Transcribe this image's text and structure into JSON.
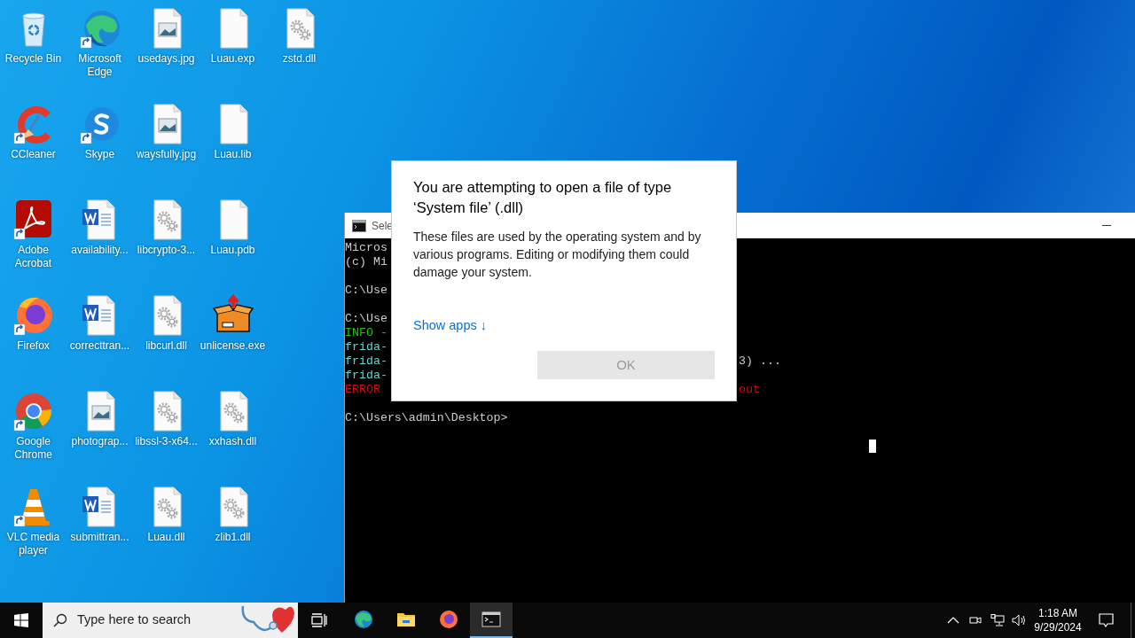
{
  "desktop_rows": [
    [
      {
        "label": "Recycle Bin",
        "kind": "recycle",
        "shortcut": false
      },
      {
        "label": "Microsoft Edge",
        "kind": "edge",
        "shortcut": true
      },
      {
        "label": "usedays.jpg",
        "kind": "image",
        "shortcut": false
      },
      {
        "label": "Luau.exp",
        "kind": "blank",
        "shortcut": false
      },
      {
        "label": "zstd.dll",
        "kind": "dll",
        "shortcut": false
      }
    ],
    [
      {
        "label": "CCleaner",
        "kind": "ccleaner",
        "shortcut": true
      },
      {
        "label": "Skype",
        "kind": "skype",
        "shortcut": true
      },
      {
        "label": "waysfully.jpg",
        "kind": "image",
        "shortcut": false
      },
      {
        "label": "Luau.lib",
        "kind": "blank",
        "shortcut": false
      }
    ],
    [
      {
        "label": "Adobe Acrobat",
        "kind": "pdf",
        "shortcut": true
      },
      {
        "label": "availability...",
        "kind": "word",
        "shortcut": false
      },
      {
        "label": "libcrypto-3...",
        "kind": "dll",
        "shortcut": false
      },
      {
        "label": "Luau.pdb",
        "kind": "blank",
        "shortcut": false
      }
    ],
    [
      {
        "label": "Firefox",
        "kind": "firefox",
        "shortcut": true
      },
      {
        "label": "correcttran...",
        "kind": "word",
        "shortcut": false
      },
      {
        "label": "libcurl.dll",
        "kind": "dll",
        "shortcut": false
      },
      {
        "label": "unlicense.exe",
        "kind": "package",
        "shortcut": false
      }
    ],
    [
      {
        "label": "Google Chrome",
        "kind": "chrome",
        "shortcut": true
      },
      {
        "label": "photograp...",
        "kind": "image",
        "shortcut": false
      },
      {
        "label": "libssl-3-x64...",
        "kind": "dll",
        "shortcut": false
      },
      {
        "label": "xxhash.dll",
        "kind": "dll",
        "shortcut": false
      }
    ],
    [
      {
        "label": "VLC media player",
        "kind": "vlc",
        "shortcut": true
      },
      {
        "label": "submittran...",
        "kind": "word",
        "shortcut": false
      },
      {
        "label": "Luau.dll",
        "kind": "dll",
        "shortcut": false
      },
      {
        "label": "zlib1.dll",
        "kind": "dll",
        "shortcut": false
      }
    ]
  ],
  "console": {
    "title": "Sele",
    "blocks": [
      [
        {
          "text": "Micros",
          "color": "#cccccc"
        },
        {
          "text": "(c) Mi",
          "color": "#cccccc"
        }
      ],
      [
        {
          "text": "C:\\Use",
          "color": "#cccccc"
        }
      ],
      [
        {
          "text": "C:\\Use",
          "color": "#cccccc"
        },
        {
          "text": "INFO -",
          "color": "#16c60c"
        },
        {
          "text": "frida-",
          "color": "#61d6d6"
        },
        {
          "text": "frida-",
          "color": "#61d6d6",
          "tail": {
            "text": "3) ...",
            "color": "#cccccc"
          }
        },
        {
          "text": "frida-",
          "color": "#61d6d6"
        },
        {
          "text": "ERROR",
          "color": "#c50f0f",
          "tail": {
            "text": "out",
            "color": "#c50f0f"
          }
        }
      ],
      [
        {
          "text": "C:\\Users\\admin\\Desktop>",
          "color": "#cccccc"
        }
      ]
    ]
  },
  "dialog": {
    "title": "You are attempting to open a file of type ‘System file’ (.dll)",
    "body": "These files are used by the operating system and by various programs. Editing or modifying them could damage your system.",
    "link": "Show apps ↓",
    "ok_button": {
      "label": "OK",
      "disabled": true
    }
  },
  "taskbar": {
    "search_placeholder": "Type here to search",
    "apps": [
      {
        "kind": "edge",
        "selected": false
      },
      {
        "kind": "explorer",
        "selected": false
      },
      {
        "kind": "firefox",
        "selected": false
      },
      {
        "kind": "terminal",
        "selected": true
      }
    ],
    "time": "1:18 AM",
    "date": "9/29/2024"
  }
}
